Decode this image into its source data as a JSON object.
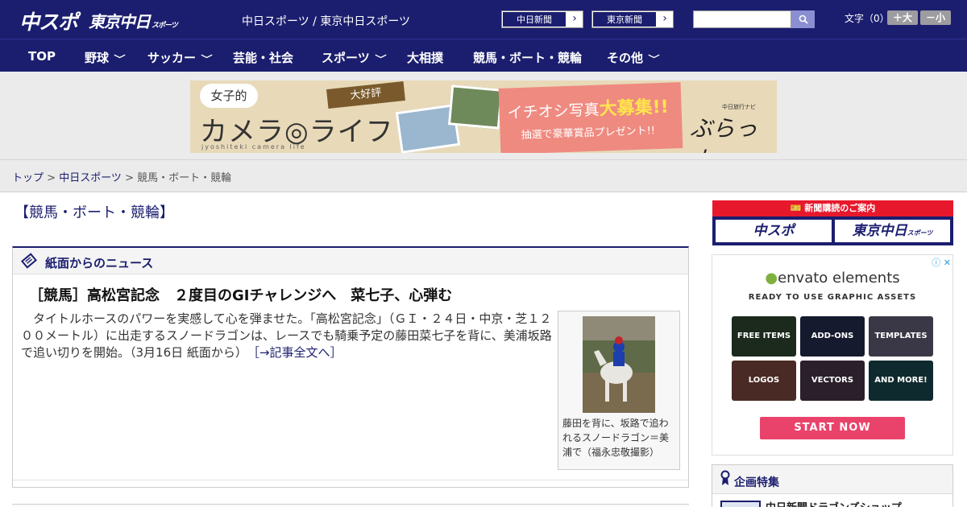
{
  "header": {
    "logo_chuspo": "中スポ",
    "logo_tokyo": "東京中日",
    "logo_tokyo_small": "スポーツ",
    "site_links": "中日スポーツ / 東京中日スポーツ",
    "paper_buttons": [
      "中日新聞",
      "東京新聞"
    ],
    "search_placeholder": "",
    "font_size_label": "文字（0）",
    "font_up": "＋大",
    "font_down": "－小"
  },
  "nav": {
    "items": [
      {
        "label": "TOP"
      },
      {
        "label": "野球"
      },
      {
        "label": "サッカー"
      },
      {
        "label": "芸能・社会"
      },
      {
        "label": "スポーツ"
      },
      {
        "label": "大相撲"
      },
      {
        "label": "競馬・ボート・競輪"
      },
      {
        "label": "その他"
      }
    ],
    "chevron": "﹀"
  },
  "banner": {
    "bubble": "女子的",
    "title": "カメラ◎ライフ",
    "subtitle": "jyoshiteki camera life",
    "ribbon": "大好評",
    "pink_a_prefix": "イチオシ写真",
    "pink_a_emph": "大募集!!",
    "pink_b": "抽選で豪華賞品プレゼント!!",
    "burat_label": "中日旅行ナビ",
    "burat": "ぶらっ人"
  },
  "breadcrumb": {
    "top": "トップ",
    "sep": " > ",
    "section": "中日スポーツ",
    "current": "競馬・ボート・競輪"
  },
  "main": {
    "category_title": "【競馬・ボート・競輪】",
    "news_header": "紙面からのニュース",
    "article_title": "［競馬］高松宮記念　２度目のGIチャレンジへ　菜七子、心弾む",
    "article_body": "タイトルホースのパワーを実感して心を弾ませた。「高松宮記念」（ＧＩ・２４日・中京・芝１２００メートル）に出走するスノードラゴンは、レースでも騎乗予定の藤田菜七子を背に、美浦坂路で追い切りを開始。（3月16日 紙面から）",
    "article_link": "［→記事全文へ］",
    "photo_caption": "藤田を背に、坂路で追われるスノードラゴン＝美浦で（福永忠敬撮影）"
  },
  "sidebar": {
    "subscribe_header": "新聞購読のご案内",
    "subscribe_chuspo": "中スポ",
    "subscribe_tokyo": "東京中日",
    "subscribe_tokyo_small": "スポーツ",
    "ad_mark": "ⓘ ✕",
    "envato_brand_leaf": "●",
    "envato_brand": "envato elements",
    "envato_tag": "READY TO USE GRAPHIC ASSETS",
    "tiles": [
      "FREE ITEMS",
      "ADD-ONS",
      "TEMPLATES",
      "LOGOS",
      "VECTORS",
      "AND MORE!"
    ],
    "envato_cta": "START NOW",
    "feature_title": "企画特集",
    "feature_item": "中日新聞ドラゴンズショップ"
  },
  "colors": {
    "brand_navy": "#1b1e6e",
    "subscribe_red": "#e8182c",
    "envato_pink": "#e9436b"
  }
}
